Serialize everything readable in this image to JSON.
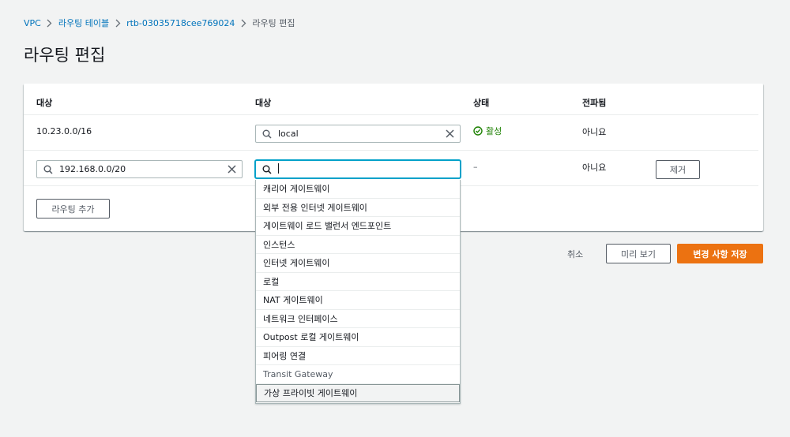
{
  "breadcrumb": {
    "items": [
      "VPC",
      "라우팅 테이블",
      "rtb-03035718cee769024",
      "라우팅 편집"
    ]
  },
  "page": {
    "title": "라우팅 편집"
  },
  "table": {
    "headers": [
      "대상",
      "대상",
      "상태",
      "전파됨"
    ],
    "rows": [
      {
        "destination": "10.23.0.0/16",
        "target": "local",
        "status": "활성",
        "propagated": "아니요"
      },
      {
        "destination": "192.168.0.0/20",
        "target": "",
        "status": "–",
        "propagated": "아니요",
        "remove_label": "제거"
      }
    ],
    "add_route_label": "라우팅 추가"
  },
  "dropdown": {
    "options": [
      "캐리어 게이트웨이",
      "외부 전용 인터넷 게이트웨이",
      "게이트웨이 로드 밸런서 엔드포인트",
      "인스턴스",
      "인터넷 게이트웨이",
      "로컬",
      "NAT 게이트웨이",
      "네트워크 인터페이스",
      "Outpost 로컬 게이트웨이",
      "피어링 연결",
      "Transit Gateway",
      "가상 프라이빗 게이트웨이"
    ],
    "highlighted_index": 11
  },
  "footer": {
    "cancel_label": "취소",
    "preview_label": "미리 보기",
    "save_label": "변경 사항 저장"
  },
  "colors": {
    "link": "#0073bb",
    "primary": "#ec7211",
    "success": "#1d8102",
    "focus": "#00a1c9"
  },
  "icons": {
    "breadcrumb_separator": "chevron-right-icon",
    "search": "search-icon",
    "clear": "close-icon",
    "status": "check-circle-icon"
  }
}
